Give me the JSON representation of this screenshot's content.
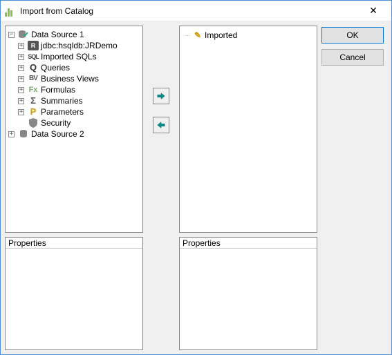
{
  "window": {
    "title": "Import from Catalog"
  },
  "buttons": {
    "ok": "OK",
    "cancel": "Cancel"
  },
  "move": {
    "right": "Move right",
    "left": "Move left"
  },
  "panels": {
    "left_props_header": "Properties",
    "right_props_header": "Properties"
  },
  "left_tree": {
    "root1": {
      "label": "Data Source 1",
      "expanded": true,
      "toggle": "−",
      "children": [
        {
          "icon": "R",
          "label": "jdbc:hsqldb:JRDemo",
          "toggle": "+"
        },
        {
          "icon": "SQL",
          "label": "Imported SQLs",
          "toggle": "+"
        },
        {
          "icon": "Q",
          "label": "Queries",
          "toggle": "+"
        },
        {
          "icon": "BV",
          "label": "Business Views",
          "toggle": "+"
        },
        {
          "icon": "Fx",
          "label": "Formulas",
          "toggle": "+"
        },
        {
          "icon": "Σ",
          "label": "Summaries",
          "toggle": "+"
        },
        {
          "icon": "P",
          "label": "Parameters",
          "toggle": "+"
        },
        {
          "icon": "🛡",
          "label": "Security",
          "toggle": ""
        }
      ]
    },
    "root2": {
      "label": "Data Source 2",
      "expanded": false,
      "toggle": "+"
    }
  },
  "right_tree": {
    "root": {
      "label": "Imported"
    }
  }
}
